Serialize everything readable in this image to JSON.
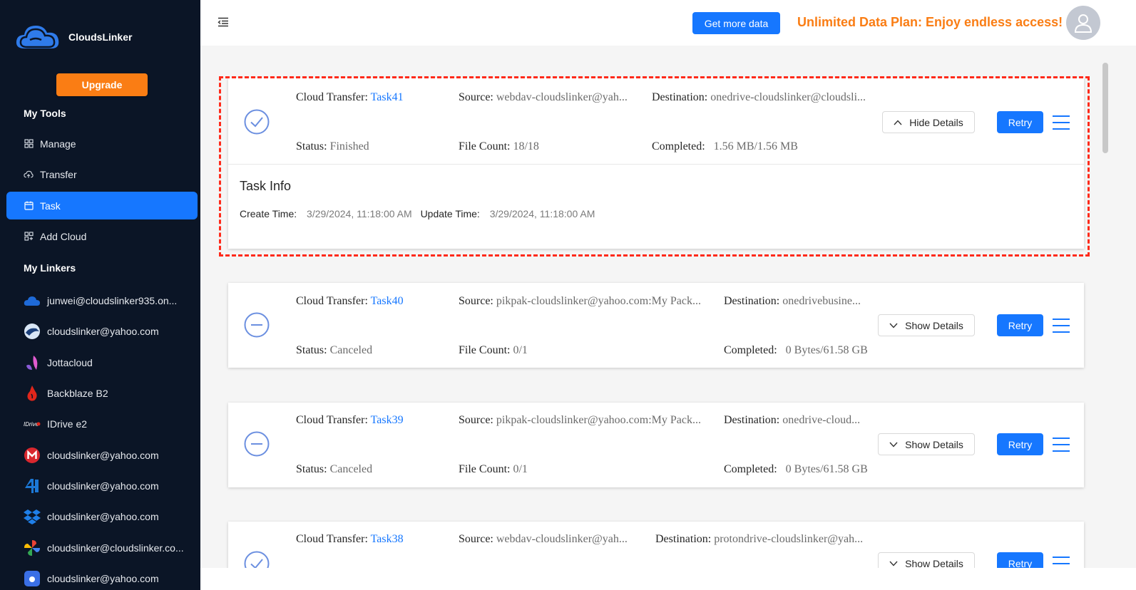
{
  "app": {
    "name": "CloudsLinker"
  },
  "sidebar": {
    "upgrade_label": "Upgrade",
    "my_tools_title": "My Tools",
    "nav": [
      {
        "label": "Manage",
        "icon": "grid-icon"
      },
      {
        "label": "Transfer",
        "icon": "cloud-transfer-icon"
      },
      {
        "label": "Task",
        "icon": "calendar-icon",
        "active": true
      },
      {
        "label": "Add Cloud",
        "icon": "add-grid-icon"
      }
    ],
    "my_linkers_title": "My Linkers",
    "linkers": [
      {
        "label": "junwei@cloudslinker935.on...",
        "icon": "onedrive-icon"
      },
      {
        "label": "cloudslinker@yahoo.com",
        "icon": "pcloud-icon"
      },
      {
        "label": "Jottacloud",
        "icon": "jottacloud-icon"
      },
      {
        "label": "Backblaze B2",
        "icon": "backblaze-icon"
      },
      {
        "label": "IDrive e2",
        "icon": "idrive-icon"
      },
      {
        "label": "cloudslinker@yahoo.com",
        "icon": "mega-icon"
      },
      {
        "label": "cloudslinker@yahoo.com",
        "icon": "4shared-icon"
      },
      {
        "label": "cloudslinker@yahoo.com",
        "icon": "dropbox-icon"
      },
      {
        "label": "cloudslinker@cloudslinker.co...",
        "icon": "google-photos-icon"
      },
      {
        "label": "cloudslinker@yahoo.com",
        "icon": "cloud-app-icon"
      }
    ]
  },
  "header": {
    "get_data_label": "Get more data",
    "promo_text": "Unlimited Data Plan: Enjoy endless access!"
  },
  "labels": {
    "cloud_transfer": "Cloud Transfer:",
    "source": "Source:",
    "destination": "Destination:",
    "status": "Status:",
    "file_count": "File Count:",
    "completed": "Completed:",
    "retry": "Retry",
    "hide_details": "Hide Details",
    "show_details": "Show Details",
    "task_info": "Task Info",
    "create_time": "Create Time:",
    "update_time": "Update Time:"
  },
  "tasks": [
    {
      "name": "Task41",
      "source": "webdav-cloudslinker@yah...",
      "destination": "onedrive-cloudslinker@cloudsli...",
      "status": "Finished",
      "file_count": "18/18",
      "completed": "1.56 MB/1.56 MB",
      "state_icon": "check-circle-icon",
      "expanded": true,
      "create_time": "3/29/2024, 11:18:00 AM",
      "update_time": "3/29/2024, 11:18:00 AM"
    },
    {
      "name": "Task40",
      "source": "pikpak-cloudslinker@yahoo.com:My Pack...",
      "destination": "onedrivebusine...",
      "status": "Canceled",
      "file_count": "0/1",
      "completed": "0 Bytes/61.58 GB",
      "state_icon": "minus-circle-icon",
      "expanded": false
    },
    {
      "name": "Task39",
      "source": "pikpak-cloudslinker@yahoo.com:My Pack...",
      "destination": "onedrive-cloud...",
      "status": "Canceled",
      "file_count": "0/1",
      "completed": "0 Bytes/61.58 GB",
      "state_icon": "minus-circle-icon",
      "expanded": false
    },
    {
      "name": "Task38",
      "source": "webdav-cloudslinker@yah...",
      "destination": "protondrive-cloudslinker@yah...",
      "state_icon": "check-circle-icon",
      "expanded": false
    }
  ]
}
